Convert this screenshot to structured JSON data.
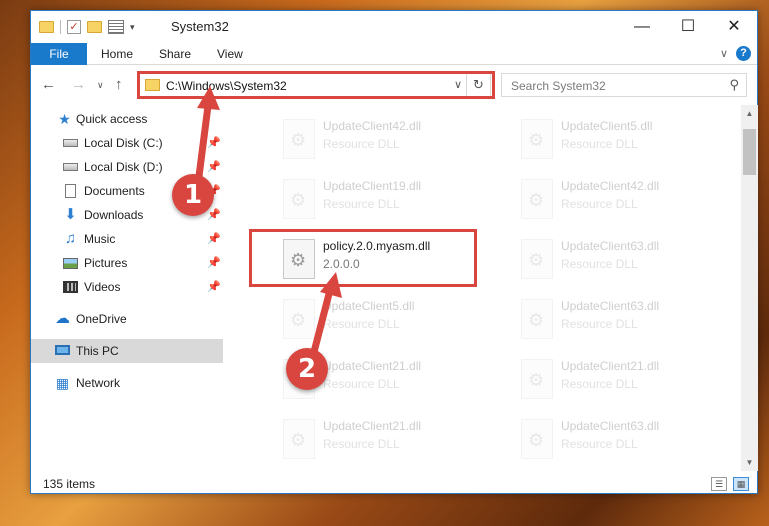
{
  "window": {
    "title": "System32"
  },
  "ribbon": {
    "file": "File",
    "home": "Home",
    "share": "Share",
    "view": "View"
  },
  "address": {
    "path": "C:\\Windows\\System32"
  },
  "search": {
    "placeholder": "Search System32"
  },
  "sidebar": {
    "items": [
      {
        "label": "Quick access",
        "icon": "star-icon"
      },
      {
        "label": "Local Disk (C:)",
        "icon": "drive-icon",
        "pinned": true
      },
      {
        "label": "Local Disk (D:)",
        "icon": "drive-icon",
        "pinned": true
      },
      {
        "label": "Documents",
        "icon": "documents-icon",
        "pinned": true
      },
      {
        "label": "Downloads",
        "icon": "downloads-icon",
        "pinned": true
      },
      {
        "label": "Music",
        "icon": "music-icon",
        "pinned": true
      },
      {
        "label": "Pictures",
        "icon": "pictures-icon",
        "pinned": true
      },
      {
        "label": "Videos",
        "icon": "videos-icon",
        "pinned": true
      },
      {
        "label": "OneDrive",
        "icon": "cloud-icon"
      },
      {
        "label": "This PC",
        "icon": "computer-icon",
        "selected": true
      },
      {
        "label": "Network",
        "icon": "network-icon"
      }
    ]
  },
  "files": [
    {
      "name": "UpdateClient42.dll",
      "desc": "Resource DLL",
      "faded": true
    },
    {
      "name": "UpdateClient5.dll",
      "desc": "Resource DLL",
      "faded": true
    },
    {
      "name": "UpdateClient19.dll",
      "desc": "Resource DLL",
      "faded": true
    },
    {
      "name": "UpdateClient42.dll",
      "desc": "Resource DLL",
      "faded": true
    },
    {
      "name": "policy.2.0.myasm.dll",
      "desc": "2.0.0.0",
      "faded": false
    },
    {
      "name": "UpdateClient63.dll",
      "desc": "Resource DLL",
      "faded": true
    },
    {
      "name": "UpdateClient5.dll",
      "desc": "Resource DLL",
      "faded": true
    },
    {
      "name": "UpdateClient63.dll",
      "desc": "Resource DLL",
      "faded": true
    },
    {
      "name": "UpdateClient21.dll",
      "desc": "Resource DLL",
      "faded": true
    },
    {
      "name": "UpdateClient21.dll",
      "desc": "Resource DLL",
      "faded": true
    },
    {
      "name": "UpdateClient21.dll",
      "desc": "Resource DLL",
      "faded": true
    },
    {
      "name": "UpdateClient63.dll",
      "desc": "Resource DLL",
      "faded": true
    }
  ],
  "status": {
    "count": "135 items"
  },
  "annotations": {
    "step1": "1",
    "step2": "2",
    "color": "#d9453f"
  }
}
